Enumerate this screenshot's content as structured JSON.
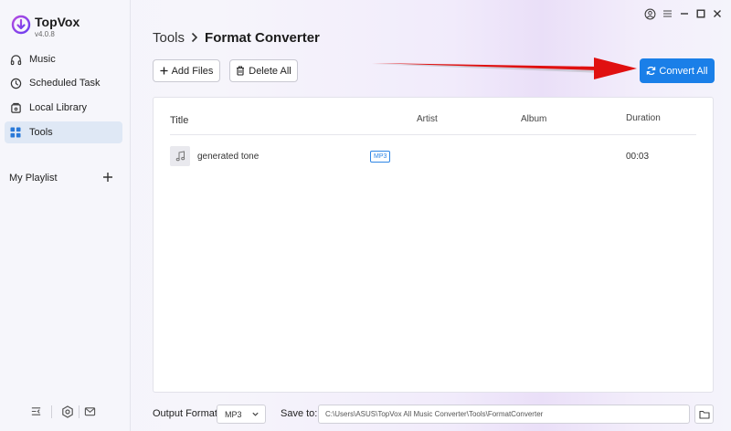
{
  "app": {
    "name": "TopVox",
    "version": "v4.0.8",
    "accent_color": "#1a7fe8"
  },
  "sidebar": {
    "items": [
      {
        "label": "Music",
        "icon": "headphones-icon",
        "active": false
      },
      {
        "label": "Scheduled Task",
        "icon": "clock-icon",
        "active": false
      },
      {
        "label": "Local Library",
        "icon": "library-icon",
        "active": false
      },
      {
        "label": "Tools",
        "icon": "grid-icon",
        "active": true
      }
    ],
    "playlist_label": "My Playlist",
    "playlist_add_icon": "plus-icon",
    "bottom_icons": [
      "collapse-sidebar-icon",
      "settings-icon",
      "mail-icon"
    ]
  },
  "window_controls": [
    "account-icon",
    "menu-icon",
    "minimize-icon",
    "maximize-icon",
    "close-icon"
  ],
  "header": {
    "breadcrumb_parent": "Tools",
    "breadcrumb_current": "Format Converter"
  },
  "toolbar": {
    "add_files_label": "Add Files",
    "delete_all_label": "Delete All",
    "convert_all_label": "Convert All"
  },
  "table": {
    "columns": {
      "title": "Title",
      "artist": "Artist",
      "album": "Album",
      "duration": "Duration"
    },
    "rows": [
      {
        "title": "generated tone",
        "format": "MP3",
        "artist": "",
        "album": "",
        "duration": "00:03",
        "thumb_icon": "music-note-icon"
      }
    ]
  },
  "footer": {
    "output_format_label": "Output Format:",
    "output_format_value": "MP3",
    "save_to_label": "Save to:",
    "save_path": "C:\\Users\\ASUS\\TopVox All Music Converter\\Tools\\FormatConverter"
  }
}
